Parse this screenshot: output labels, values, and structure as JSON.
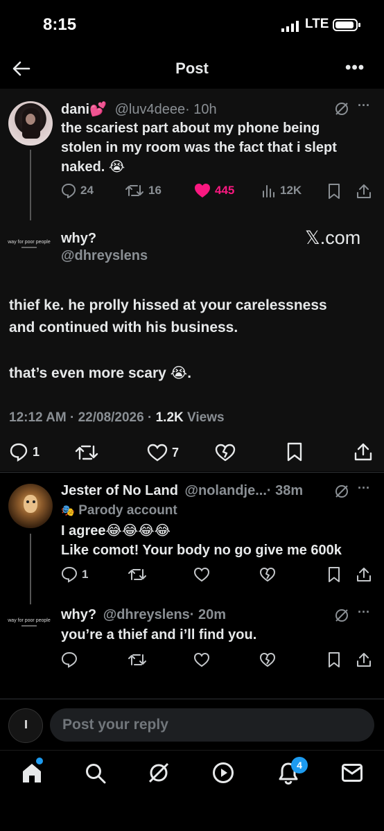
{
  "status_bar": {
    "time": "8:15",
    "network": "LTE"
  },
  "header": {
    "title": "Post",
    "more": "•••"
  },
  "original_post": {
    "display_name": "dani",
    "name_emoji": "💕",
    "handle": "@luv4deee",
    "time": "· 10h",
    "text_lines": [
      "the scariest part about my phone being",
      "stolen in my room was the fact that i slept",
      "naked. 😭"
    ],
    "replies": "24",
    "reposts": "16",
    "likes": "445",
    "views": "12K",
    "like_color": "#f91880"
  },
  "main_post": {
    "avatar_text": "way for poor people",
    "display_name": "why?",
    "handle": "@dhreyslens",
    "watermark": "𝕏.com",
    "text_line1": "thief ke. he prolly hissed at your carelessness",
    "text_line2": "and continued with his business.",
    "text_line3": "that’s even more scary 😭.",
    "meta_time": "12:12 AM · 22/08/2026 · ",
    "meta_views_count": "1.2K",
    "meta_views_label": " Views",
    "replies": "1",
    "likes": "7"
  },
  "reply1": {
    "display_name": "Jester of No Land",
    "handle": "@nolandje...",
    "time": "· 38m",
    "parody": "Parody account",
    "text_line1": "I agree😂😂😂😂",
    "text_line2": "Like comot! Your body no go give me 600k",
    "replies": "1"
  },
  "reply2": {
    "avatar_text": "way for poor people",
    "display_name": "why?",
    "handle": "@dhreyslens",
    "time": "· 20m",
    "text": "you’re a thief and i’ll find you."
  },
  "compose": {
    "placeholder": "Post your reply"
  },
  "nav": {
    "notifications_badge": "4",
    "accent": "#1d9bf0"
  }
}
